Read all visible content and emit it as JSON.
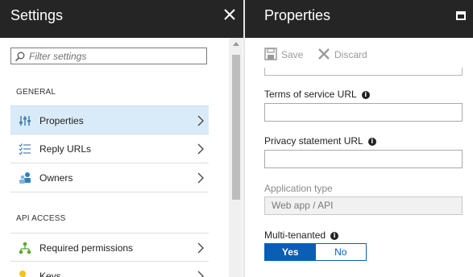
{
  "settings": {
    "title": "Settings",
    "filter_placeholder": "Filter settings",
    "sections": {
      "general": "GENERAL",
      "api_access": "API ACCESS"
    },
    "general_items": [
      {
        "label": "Properties",
        "icon": "properties-icon",
        "selected": true
      },
      {
        "label": "Reply URLs",
        "icon": "reply-urls-icon",
        "selected": false
      },
      {
        "label": "Owners",
        "icon": "owners-icon",
        "selected": false
      }
    ],
    "api_items": [
      {
        "label": "Required permissions",
        "icon": "required-permissions-icon"
      },
      {
        "label": "Keys",
        "icon": "keys-icon"
      }
    ]
  },
  "properties": {
    "title": "Properties",
    "save_label": "Save",
    "discard_label": "Discard",
    "terms_label": "Terms of service URL",
    "terms_value": "",
    "privacy_label": "Privacy statement URL",
    "privacy_value": "",
    "app_type_label": "Application type",
    "app_type_value": "Web app / API",
    "multi_tenanted_label": "Multi-tenanted",
    "toggle_yes": "Yes",
    "toggle_no": "No",
    "multi_tenanted_selected": "Yes"
  },
  "colors": {
    "header_bg": "#252526",
    "selected_bg": "#d9ebf9",
    "accent": "#0a5fb4"
  }
}
